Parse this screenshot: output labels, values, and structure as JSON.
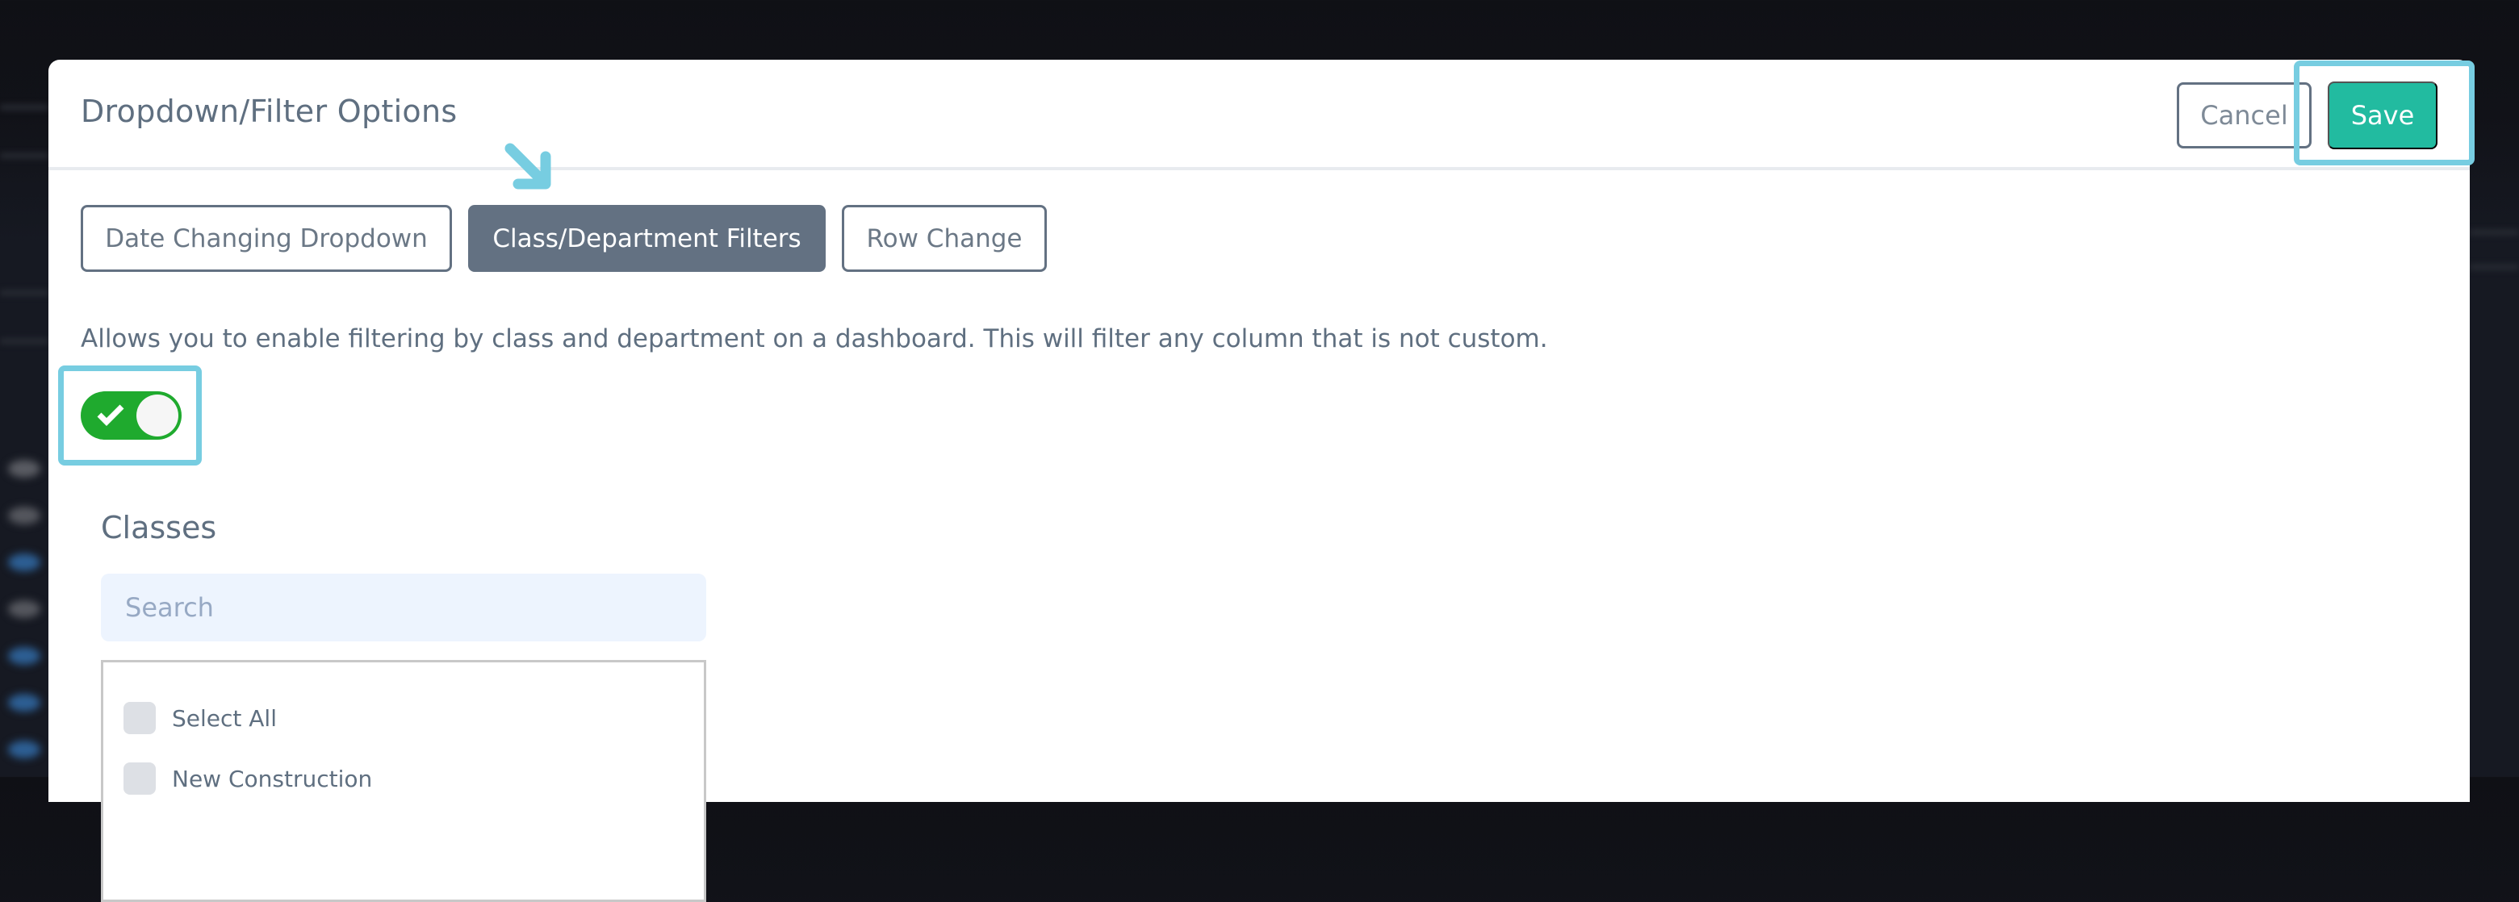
{
  "modal": {
    "title": "Dropdown/Filter Options",
    "cancel_label": "Cancel",
    "save_label": "Save"
  },
  "tabs": [
    {
      "label": "Date Changing Dropdown",
      "active": false
    },
    {
      "label": "Class/Department Filters",
      "active": true
    },
    {
      "label": "Row Change",
      "active": false
    }
  ],
  "panel": {
    "description": "Allows you to enable filtering by class and department on a dashboard. This will filter any column that is not custom.",
    "toggle": {
      "state": "on",
      "icon": "check-icon"
    },
    "classes": {
      "title": "Classes",
      "search": {
        "placeholder": "Search",
        "value": ""
      },
      "items": [
        {
          "label": "Select All",
          "checked": false
        },
        {
          "label": "New Construction",
          "checked": false
        }
      ]
    }
  },
  "annotations": {
    "highlight_color": "#77cde1",
    "highlights": [
      "save-button",
      "enable-filter-toggle"
    ],
    "arrow_target": "tab-class-department-filters"
  },
  "colors": {
    "save_button": "#22bba0",
    "active_tab": "#637182",
    "toggle_on": "#1faa2e",
    "text": "#5f6f80",
    "search_bg": "#edf4fe"
  }
}
